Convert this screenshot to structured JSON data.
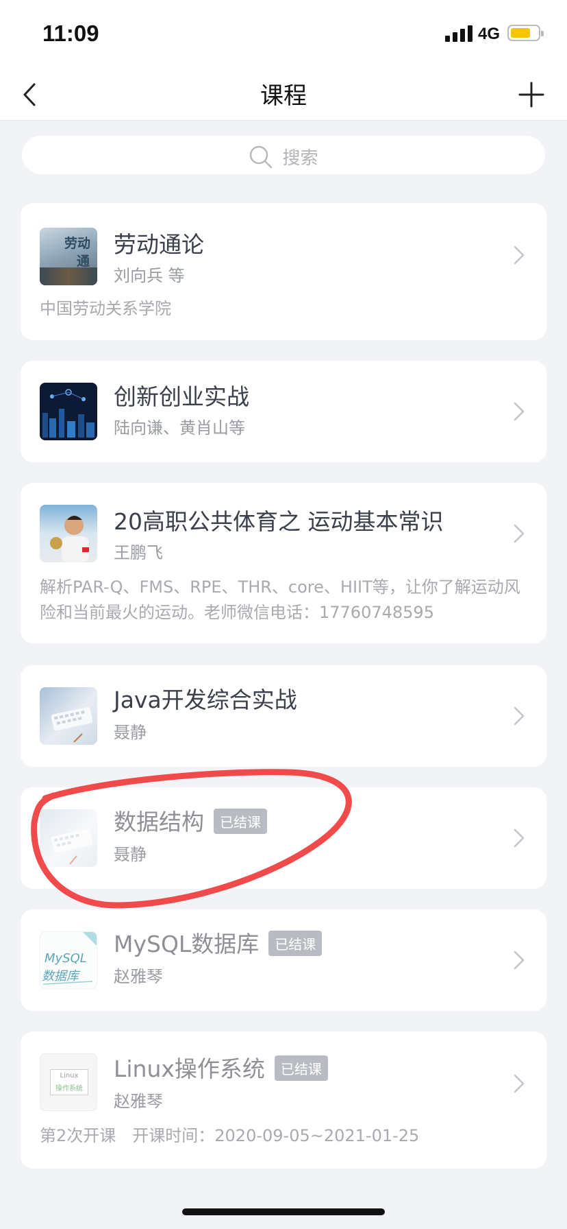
{
  "status_bar": {
    "time": "11:09",
    "network": "4G"
  },
  "nav": {
    "title": "课程",
    "back_icon": "chevron-left-icon",
    "add_icon": "plus-icon"
  },
  "search": {
    "placeholder": "搜索",
    "icon": "search-icon"
  },
  "colors": {
    "background": "#f2f3f7",
    "badge": "#b9bbc2",
    "annotation": "#f04a4a",
    "battery": "#f7c600"
  },
  "courses": [
    {
      "title": "劳动通论",
      "teacher": "刘向兵 等",
      "description": "中国劳动关系学院",
      "badge": "",
      "thumb_text": [
        "劳动",
        "通"
      ]
    },
    {
      "title": "创新创业实战",
      "teacher": "陆向谦、黄肖山等",
      "description": "",
      "badge": ""
    },
    {
      "title": "20高职公共体育之 运动基本常识",
      "teacher": "王鹏飞",
      "description": "解析PAR-Q、FMS、RPE、THR、core、HIIT等，让你了解运动风险和当前最火的运动。老师微信电话：17760748595",
      "badge": ""
    },
    {
      "title": "Java开发综合实战",
      "teacher": "聂静",
      "description": "",
      "badge": ""
    },
    {
      "title": "数据结构",
      "teacher": "聂静",
      "description": "",
      "badge": "已结课"
    },
    {
      "title": "MySQL数据库",
      "teacher": "赵雅琴",
      "description": "",
      "badge": "已结课",
      "thumb_text": [
        "MySQL",
        "数据库"
      ]
    },
    {
      "title": "Linux操作系统",
      "teacher": "赵雅琴",
      "description": "第2次开课　开课时间：2020-09-05~2021-01-25",
      "badge": "已结课",
      "thumb_text": [
        "Linux",
        "操作系统"
      ]
    }
  ]
}
